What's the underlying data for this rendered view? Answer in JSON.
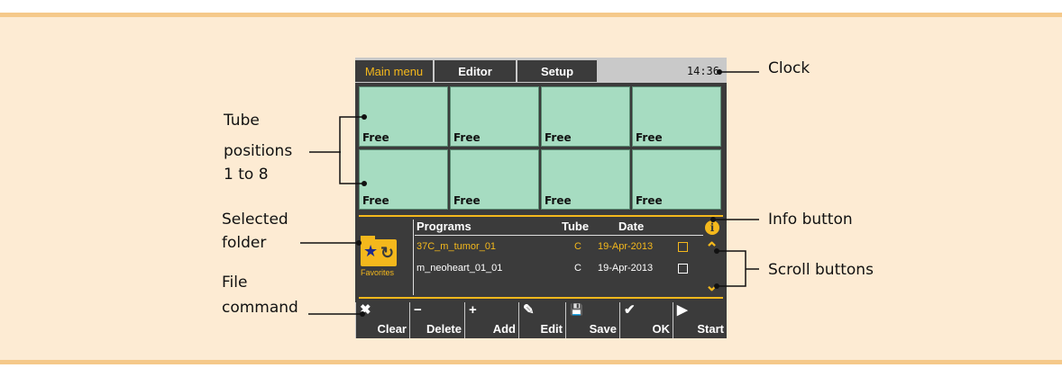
{
  "tabs": [
    {
      "label": "Main menu",
      "active": true
    },
    {
      "label": "Editor",
      "active": false
    },
    {
      "label": "Setup",
      "active": false
    }
  ],
  "clock": "14:36",
  "tubes": [
    "Free",
    "Free",
    "Free",
    "Free",
    "Free",
    "Free",
    "Free",
    "Free"
  ],
  "folder": {
    "label": "Favorites",
    "icon": "star-folder-icon"
  },
  "list": {
    "headers": {
      "programs": "Programs",
      "tube": "Tube",
      "date": "Date"
    },
    "rows": [
      {
        "name": "37C_m_tumor_01",
        "tube": "C",
        "date": "19-Apr-2013",
        "selected": true
      },
      {
        "name": "m_neoheart_01_01",
        "tube": "C",
        "date": "19-Apr-2013",
        "selected": false
      }
    ]
  },
  "commands": [
    {
      "label": "Clear",
      "icon": "✖"
    },
    {
      "label": "Delete",
      "icon": "−"
    },
    {
      "label": "Add",
      "icon": "+"
    },
    {
      "label": "Edit",
      "icon": "✎"
    },
    {
      "label": "Save",
      "icon": "💾"
    },
    {
      "label": "OK",
      "icon": "✔"
    },
    {
      "label": "Start",
      "icon": "▶"
    }
  ],
  "callouts": {
    "clock": "Clock",
    "tubes_1": "Tube",
    "tubes_2": "positions",
    "tubes_3": "1 to 8",
    "folder_1": "Selected",
    "folder_2": "folder",
    "file_1": "File",
    "file_2": "command",
    "info": "Info button",
    "scroll": "Scroll buttons"
  },
  "colors": {
    "accent": "#f4b81c",
    "tube_free": "#a6dcc1",
    "screen_bg": "#3b3b3b",
    "panel_bg": "#fdebd3"
  }
}
